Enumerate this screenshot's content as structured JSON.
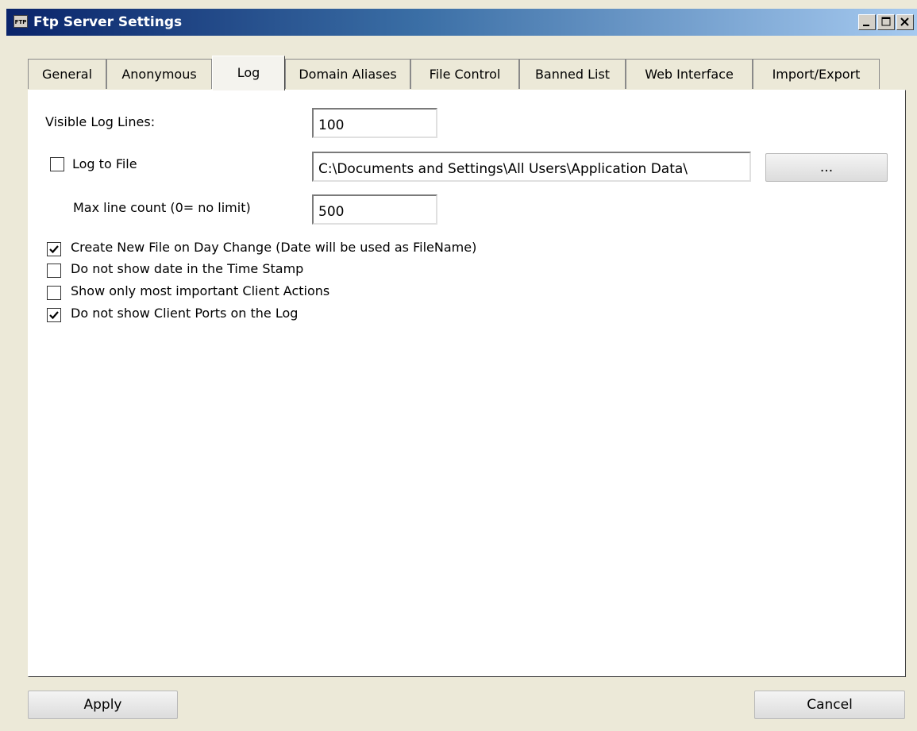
{
  "window": {
    "icon_text": "FTP",
    "title": "Ftp Server Settings"
  },
  "tabs": [
    {
      "label": "General"
    },
    {
      "label": "Anonymous"
    },
    {
      "label": "Log",
      "active": true
    },
    {
      "label": "Domain Aliases"
    },
    {
      "label": "File Control"
    },
    {
      "label": "Banned List"
    },
    {
      "label": "Web Interface"
    },
    {
      "label": "Import/Export"
    }
  ],
  "log": {
    "visible_lines_label": "Visible Log Lines:",
    "visible_lines_value": "100",
    "log_to_file_label": "Log to File",
    "log_to_file_checked": false,
    "log_path": "C:\\Documents and Settings\\All Users\\Application Data\\",
    "browse_label": "...",
    "max_line_label": "Max line count (0= no limit)",
    "max_line_value": "500",
    "options": [
      {
        "label": "Create New File on Day Change (Date will be used as FileName)",
        "checked": true
      },
      {
        "label": "Do not show date in the Time Stamp",
        "checked": false
      },
      {
        "label": "Show only most important Client Actions",
        "checked": false
      },
      {
        "label": "Do not show Client Ports on the Log",
        "checked": true
      }
    ]
  },
  "footer": {
    "apply_label": "Apply",
    "cancel_label": "Cancel"
  }
}
